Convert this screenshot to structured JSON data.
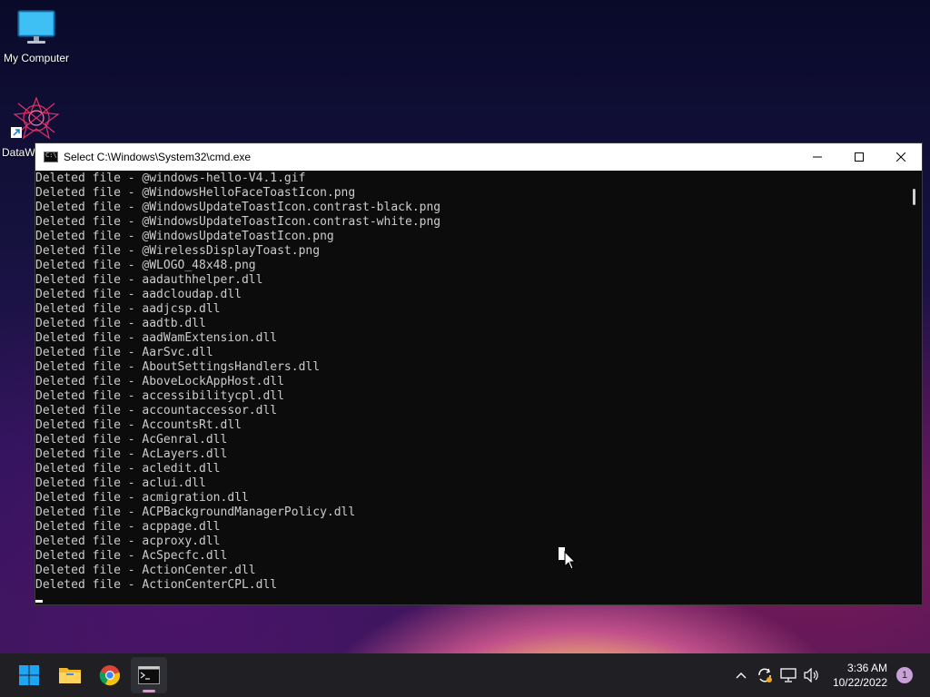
{
  "desktop": {
    "icons": [
      {
        "label": "My Computer"
      },
      {
        "label": "DataW"
      }
    ]
  },
  "window": {
    "title": "Select C:\\Windows\\System32\\cmd.exe",
    "controls": {
      "minimize": "minimize",
      "maximize": "maximize",
      "close": "close"
    }
  },
  "console": {
    "lines": [
      "Deleted file - @windows-hello-V4.1.gif",
      "Deleted file - @WindowsHelloFaceToastIcon.png",
      "Deleted file - @WindowsUpdateToastIcon.contrast-black.png",
      "Deleted file - @WindowsUpdateToastIcon.contrast-white.png",
      "Deleted file - @WindowsUpdateToastIcon.png",
      "Deleted file - @WirelessDisplayToast.png",
      "Deleted file - @WLOGO_48x48.png",
      "Deleted file - aadauthhelper.dll",
      "Deleted file - aadcloudap.dll",
      "Deleted file - aadjcsp.dll",
      "Deleted file - aadtb.dll",
      "Deleted file - aadWamExtension.dll",
      "Deleted file - AarSvc.dll",
      "Deleted file - AboutSettingsHandlers.dll",
      "Deleted file - AboveLockAppHost.dll",
      "Deleted file - accessibilitycpl.dll",
      "Deleted file - accountaccessor.dll",
      "Deleted file - AccountsRt.dll",
      "Deleted file - AcGenral.dll",
      "Deleted file - AcLayers.dll",
      "Deleted file - acledit.dll",
      "Deleted file - aclui.dll",
      "Deleted file - acmigration.dll",
      "Deleted file - ACPBackgroundManagerPolicy.dll",
      "Deleted file - acppage.dll",
      "Deleted file - acproxy.dll",
      "Deleted file - AcSpecfc.dll",
      "Deleted file - ActionCenter.dll",
      "Deleted file - ActionCenterCPL.dll"
    ]
  },
  "taskbar": {
    "apps": [
      "start",
      "file-explorer",
      "chrome",
      "cmd"
    ],
    "clock": {
      "time": "3:36 AM",
      "date": "10/22/2022"
    },
    "notification_count": "1"
  },
  "colors": {
    "console_bg": "#0c0c0c",
    "console_text": "#cccccc",
    "taskbar_bg": "#1f1f24",
    "windows_blue": "#1ea5f3"
  }
}
